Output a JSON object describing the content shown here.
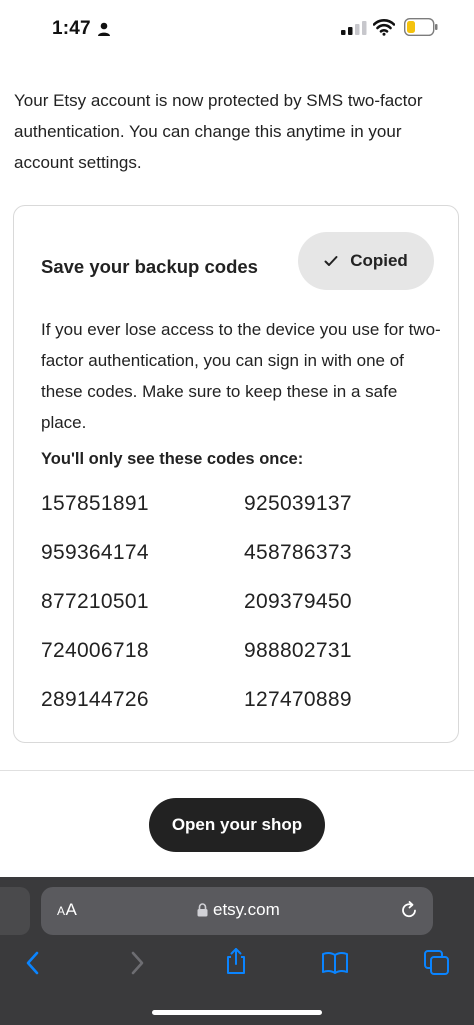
{
  "status_bar": {
    "time": "1:47"
  },
  "intro": {
    "text": "Your Etsy account is now protected by SMS two-factor authentication. You can change this anytime in your account settings."
  },
  "backup_card": {
    "title": "Save your backup codes",
    "copied_label": "Copied",
    "description": "If you ever lose access to the device you use for two-factor authentication, you can sign in with one of these codes. Make sure to keep these in a safe place.",
    "codes_heading": "You'll only see these codes once:",
    "codes": [
      "157851891",
      "925039137",
      "959364174",
      "458786373",
      "877210501",
      "209379450",
      "724006718",
      "988802731",
      "289144726",
      "127470889"
    ]
  },
  "actions": {
    "open_shop_label": "Open your shop"
  },
  "browser": {
    "aa_large": "A",
    "aa_small": "A",
    "url": "etsy.com"
  },
  "icons": {
    "person": "person-icon",
    "signal": "signal-icon",
    "wifi": "wifi-icon",
    "battery": "battery-icon",
    "check": "check-icon",
    "lock": "lock-icon",
    "reload": "reload-icon",
    "back": "back-chevron-icon",
    "forward": "forward-chevron-icon",
    "share": "share-icon",
    "bookmarks": "bookmarks-icon",
    "tabs": "tabs-icon"
  },
  "colors": {
    "primary_dark": "#222222",
    "safari_blue": "#0a84ff",
    "battery_low": "#f4c20d"
  }
}
